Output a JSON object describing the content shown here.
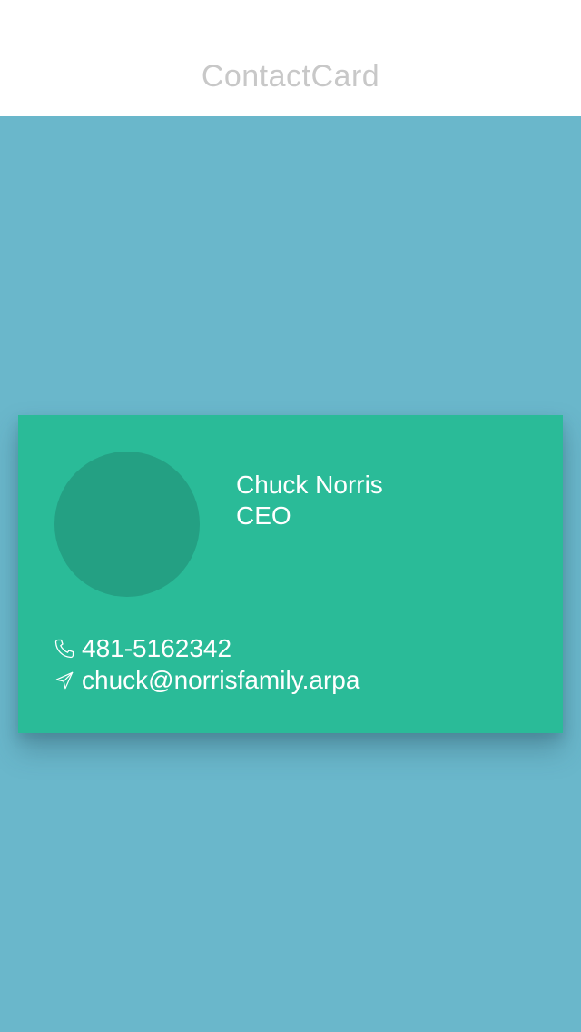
{
  "navbar": {
    "title": "ContactCard"
  },
  "card": {
    "name": "Chuck Norris",
    "role": "CEO",
    "phone": "481-5162342",
    "email": "chuck@norrisfamily.arpa",
    "phone_icon": "phone-icon",
    "email_icon": "send-icon"
  },
  "colors": {
    "background": "#6ab7cb",
    "card": "#2abb98",
    "avatar": "#24a083",
    "nav_title": "#c8c8c8"
  }
}
